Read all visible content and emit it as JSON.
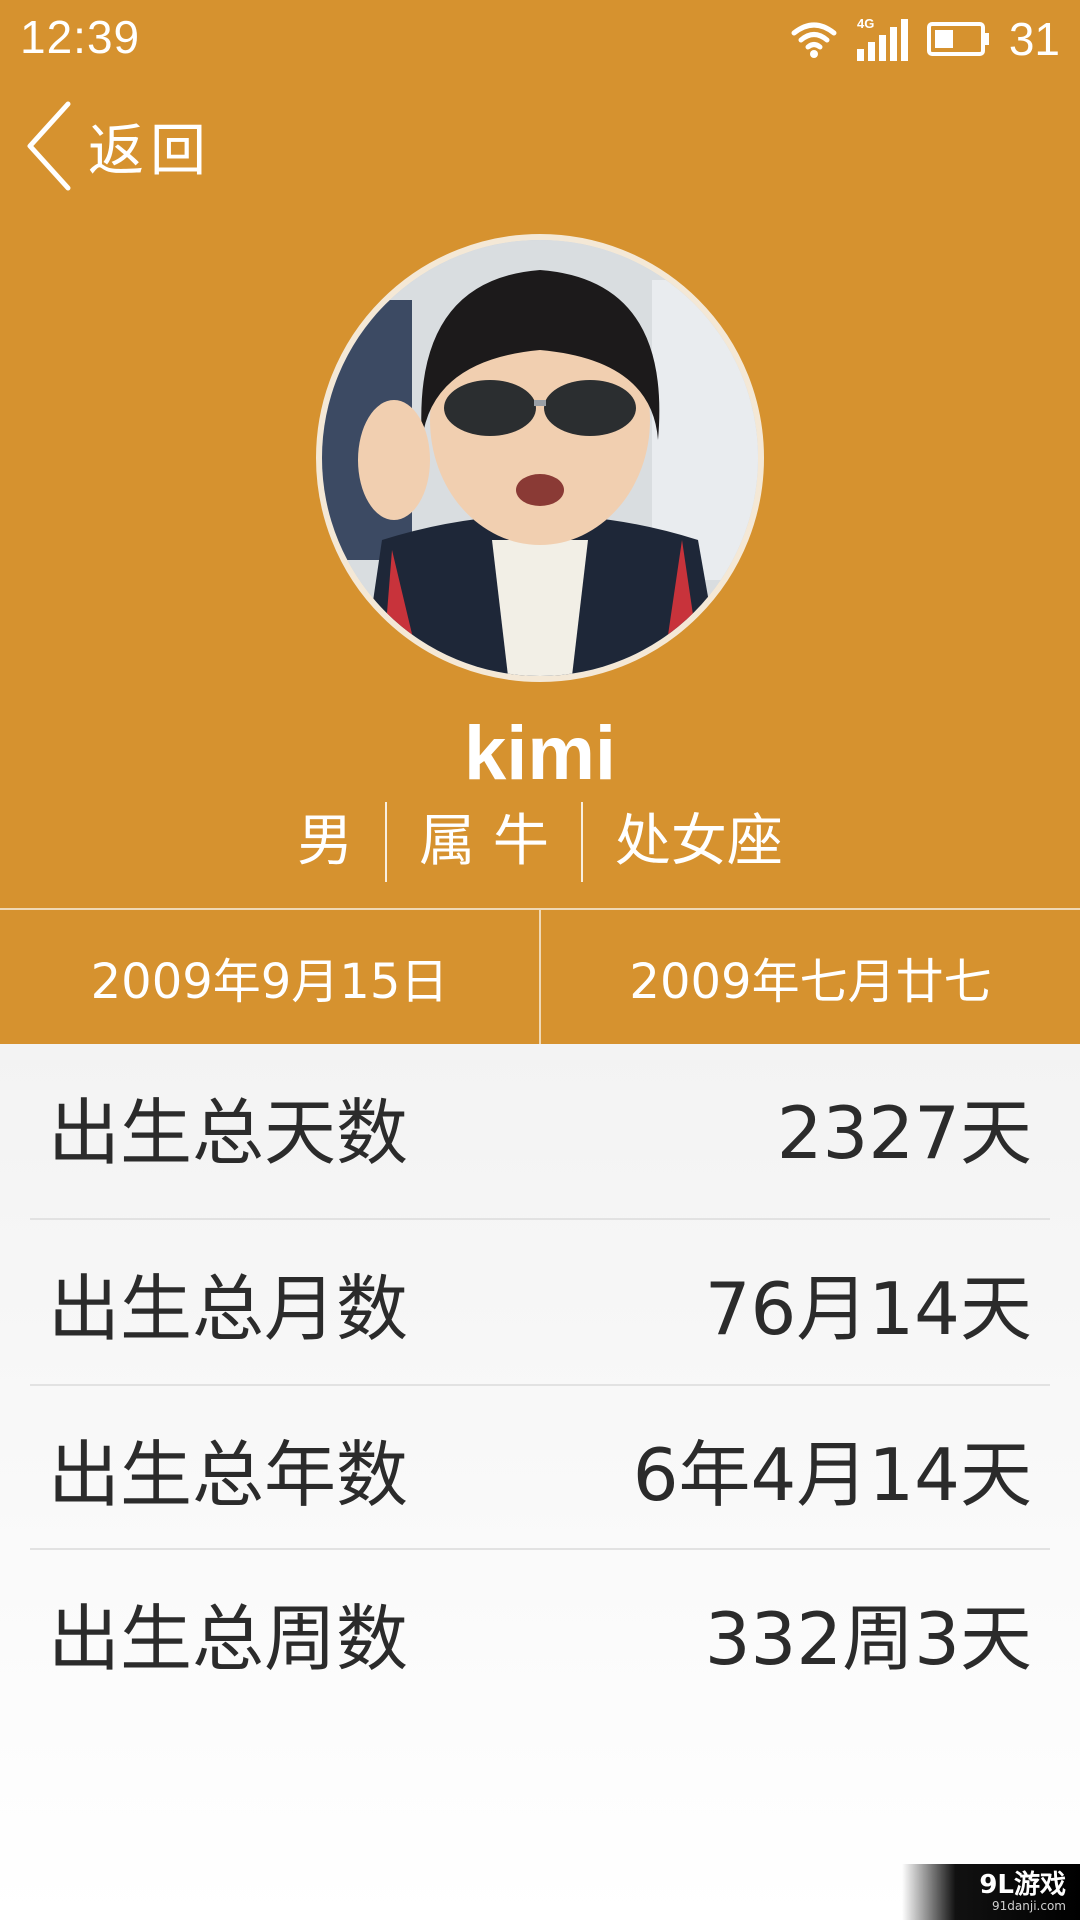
{
  "status_bar": {
    "time": "12:39",
    "network": "4G",
    "battery": "31"
  },
  "nav": {
    "back_label": "返回"
  },
  "profile": {
    "name": "kimi",
    "gender": "男",
    "zodiac": "属 牛",
    "constellation": "处女座"
  },
  "dates": {
    "solar": "2009年9月15日",
    "lunar": "2009年七月廿七"
  },
  "stats": [
    {
      "label": "出生总天数",
      "value": "2327天"
    },
    {
      "label": "出生总月数",
      "value": "76月14天"
    },
    {
      "label": "出生总年数",
      "value": "6年4月14天"
    },
    {
      "label": "出生总周数",
      "value": "332周3天"
    }
  ],
  "watermark": {
    "main": "9L游戏",
    "sub": "91danji.com"
  },
  "colors": {
    "header": "#d6922f",
    "text_dark": "#2b2b2b"
  }
}
